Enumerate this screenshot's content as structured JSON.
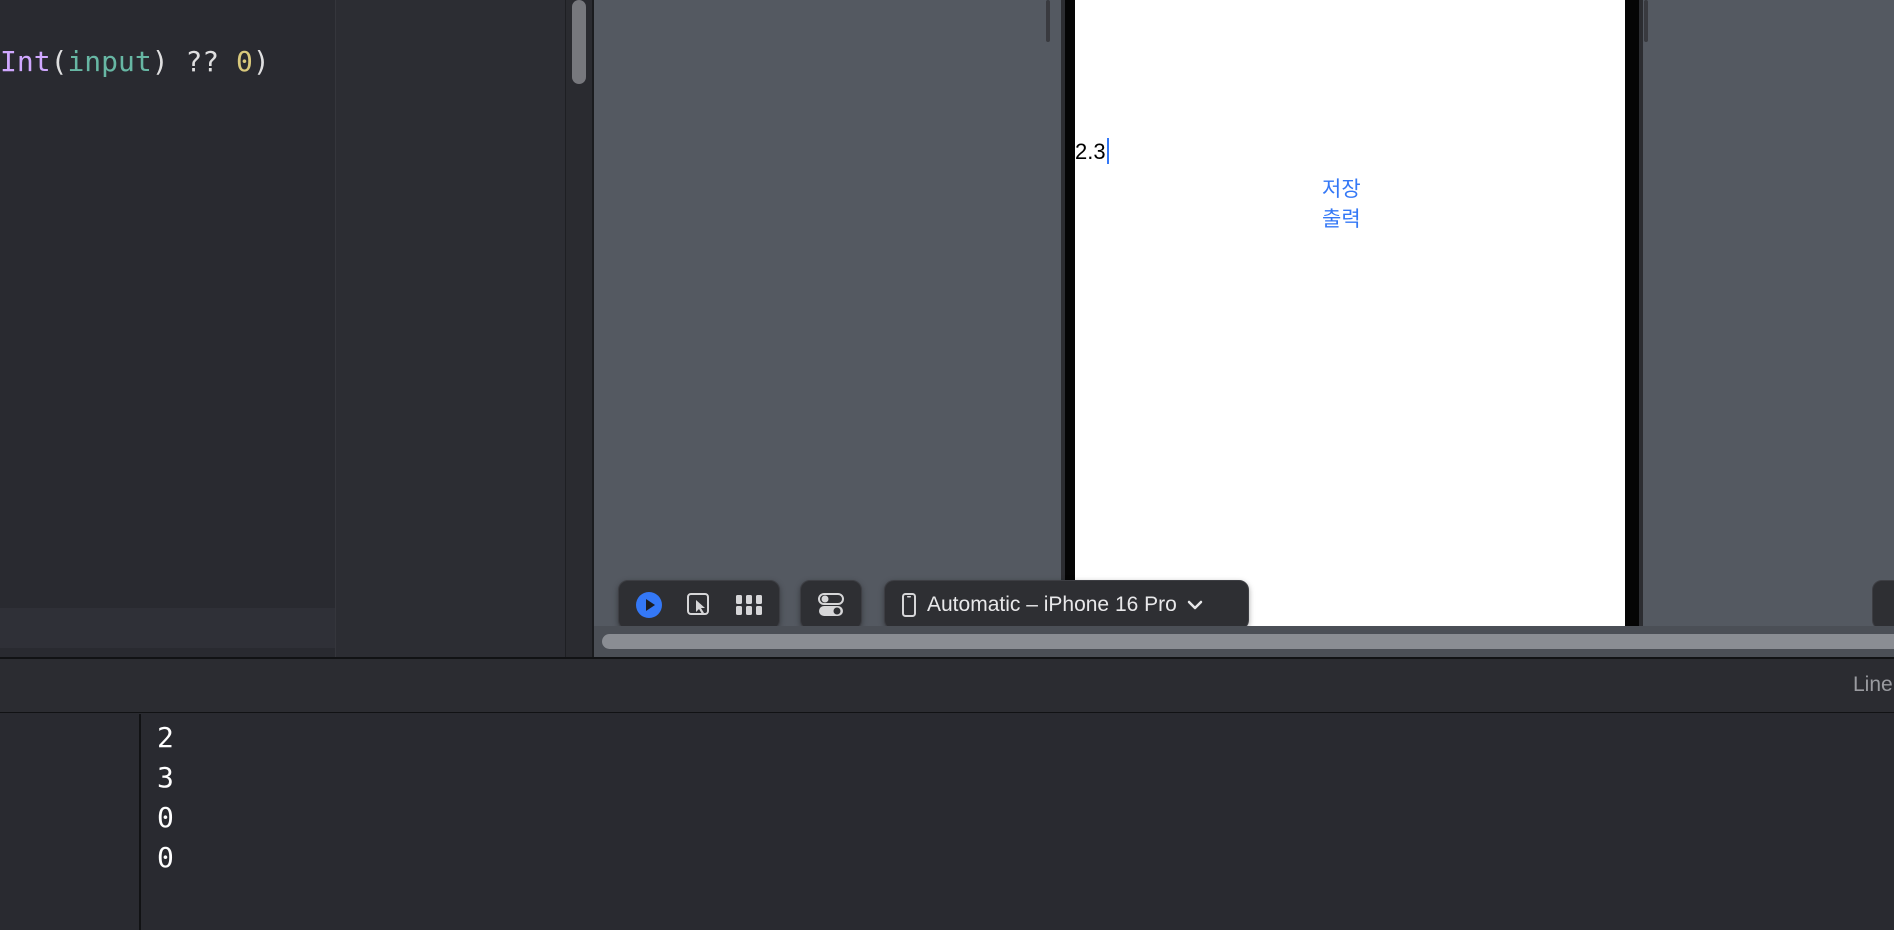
{
  "editor": {
    "code_tokens": {
      "type": "Int",
      "open_paren": "(",
      "arg": "input",
      "close_rest": ") ?? ",
      "default_value": "0",
      "close_paren": ")"
    }
  },
  "preview": {
    "text_field_value": "2.3",
    "save_button_label": "저장",
    "print_button_label": "출력",
    "device_selector_label": "Automatic – iPhone 16 Pro"
  },
  "debug": {
    "status_label": "Line",
    "console_lines": [
      "2",
      "3",
      "0",
      "0"
    ]
  },
  "colors": {
    "accent": "#3478f6",
    "keyword_type": "#d0a8ff",
    "identifier": "#67b7a4",
    "number": "#d9c97c"
  }
}
